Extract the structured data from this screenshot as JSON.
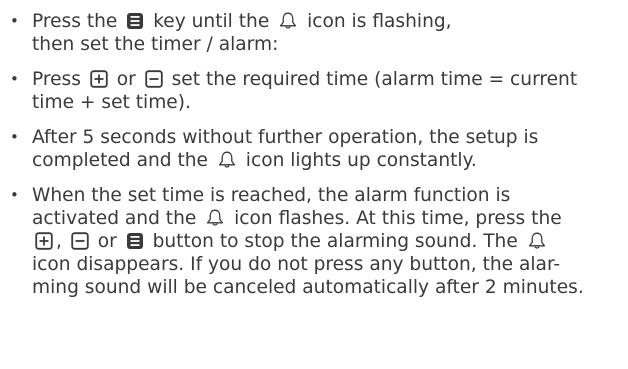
{
  "items": [
    {
      "lines": [
        [
          "Press the ",
          "{mode-button-icon}",
          " key until the ",
          "{bell-icon}",
          " icon is flashing,"
        ],
        [
          "then set the timer / alarm:"
        ]
      ]
    },
    {
      "lines": [
        [
          "Press ",
          "{plus-button-icon}",
          " or ",
          "{minus-button-icon}",
          " set the required time (alarm time = current"
        ],
        [
          "time + set time)."
        ]
      ]
    },
    {
      "lines": [
        [
          "After 5 seconds without further operation, the setup is"
        ],
        [
          "completed and the ",
          "{bell-icon}",
          " icon lights up constantly."
        ]
      ]
    },
    {
      "lines": [
        [
          "When the set time is reached, the alarm function is"
        ],
        [
          "activated and the ",
          "{bell-icon}",
          " icon flashes. At this time, press the"
        ],
        [
          "{plus-button-icon}",
          ", ",
          "{minus-button-icon}",
          " or ",
          "{mode-button-icon}",
          " button to stop the alarming sound. The ",
          "{bell-icon}"
        ],
        [
          "icon disappears. If you do not press any button, the alar-"
        ],
        [
          "ming sound will be canceled automatically after 2 minutes."
        ]
      ]
    }
  ],
  "text_color": "#3a3a3a",
  "icons": {
    "mode-button-icon": "mode-button-icon",
    "bell-icon": "bell-icon",
    "plus-button-icon": "plus-button-icon",
    "minus-button-icon": "minus-button-icon"
  }
}
